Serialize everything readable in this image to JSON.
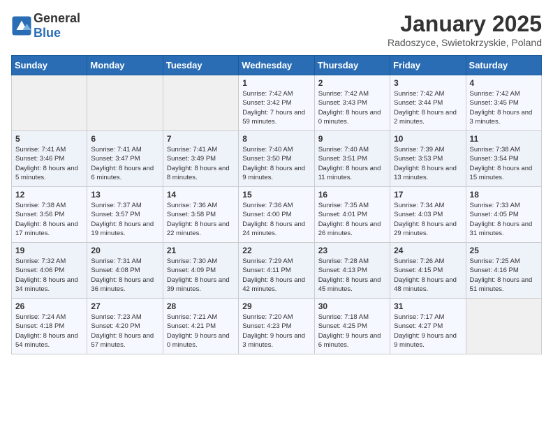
{
  "header": {
    "logo_general": "General",
    "logo_blue": "Blue",
    "title": "January 2025",
    "subtitle": "Radoszyce, Swietokrzyskie, Poland"
  },
  "weekdays": [
    "Sunday",
    "Monday",
    "Tuesday",
    "Wednesday",
    "Thursday",
    "Friday",
    "Saturday"
  ],
  "weeks": [
    [
      {
        "day": "",
        "empty": true
      },
      {
        "day": "",
        "empty": true
      },
      {
        "day": "",
        "empty": true
      },
      {
        "day": "1",
        "sunrise": "7:42 AM",
        "sunset": "3:42 PM",
        "daylight": "Daylight: 7 hours and 59 minutes."
      },
      {
        "day": "2",
        "sunrise": "7:42 AM",
        "sunset": "3:43 PM",
        "daylight": "Daylight: 8 hours and 0 minutes."
      },
      {
        "day": "3",
        "sunrise": "7:42 AM",
        "sunset": "3:44 PM",
        "daylight": "Daylight: 8 hours and 2 minutes."
      },
      {
        "day": "4",
        "sunrise": "7:42 AM",
        "sunset": "3:45 PM",
        "daylight": "Daylight: 8 hours and 3 minutes."
      }
    ],
    [
      {
        "day": "5",
        "sunrise": "7:41 AM",
        "sunset": "3:46 PM",
        "daylight": "Daylight: 8 hours and 5 minutes."
      },
      {
        "day": "6",
        "sunrise": "7:41 AM",
        "sunset": "3:47 PM",
        "daylight": "Daylight: 8 hours and 6 minutes."
      },
      {
        "day": "7",
        "sunrise": "7:41 AM",
        "sunset": "3:49 PM",
        "daylight": "Daylight: 8 hours and 8 minutes."
      },
      {
        "day": "8",
        "sunrise": "7:40 AM",
        "sunset": "3:50 PM",
        "daylight": "Daylight: 8 hours and 9 minutes."
      },
      {
        "day": "9",
        "sunrise": "7:40 AM",
        "sunset": "3:51 PM",
        "daylight": "Daylight: 8 hours and 11 minutes."
      },
      {
        "day": "10",
        "sunrise": "7:39 AM",
        "sunset": "3:53 PM",
        "daylight": "Daylight: 8 hours and 13 minutes."
      },
      {
        "day": "11",
        "sunrise": "7:38 AM",
        "sunset": "3:54 PM",
        "daylight": "Daylight: 8 hours and 15 minutes."
      }
    ],
    [
      {
        "day": "12",
        "sunrise": "7:38 AM",
        "sunset": "3:56 PM",
        "daylight": "Daylight: 8 hours and 17 minutes."
      },
      {
        "day": "13",
        "sunrise": "7:37 AM",
        "sunset": "3:57 PM",
        "daylight": "Daylight: 8 hours and 19 minutes."
      },
      {
        "day": "14",
        "sunrise": "7:36 AM",
        "sunset": "3:58 PM",
        "daylight": "Daylight: 8 hours and 22 minutes."
      },
      {
        "day": "15",
        "sunrise": "7:36 AM",
        "sunset": "4:00 PM",
        "daylight": "Daylight: 8 hours and 24 minutes."
      },
      {
        "day": "16",
        "sunrise": "7:35 AM",
        "sunset": "4:01 PM",
        "daylight": "Daylight: 8 hours and 26 minutes."
      },
      {
        "day": "17",
        "sunrise": "7:34 AM",
        "sunset": "4:03 PM",
        "daylight": "Daylight: 8 hours and 29 minutes."
      },
      {
        "day": "18",
        "sunrise": "7:33 AM",
        "sunset": "4:05 PM",
        "daylight": "Daylight: 8 hours and 31 minutes."
      }
    ],
    [
      {
        "day": "19",
        "sunrise": "7:32 AM",
        "sunset": "4:06 PM",
        "daylight": "Daylight: 8 hours and 34 minutes."
      },
      {
        "day": "20",
        "sunrise": "7:31 AM",
        "sunset": "4:08 PM",
        "daylight": "Daylight: 8 hours and 36 minutes."
      },
      {
        "day": "21",
        "sunrise": "7:30 AM",
        "sunset": "4:09 PM",
        "daylight": "Daylight: 8 hours and 39 minutes."
      },
      {
        "day": "22",
        "sunrise": "7:29 AM",
        "sunset": "4:11 PM",
        "daylight": "Daylight: 8 hours and 42 minutes."
      },
      {
        "day": "23",
        "sunrise": "7:28 AM",
        "sunset": "4:13 PM",
        "daylight": "Daylight: 8 hours and 45 minutes."
      },
      {
        "day": "24",
        "sunrise": "7:26 AM",
        "sunset": "4:15 PM",
        "daylight": "Daylight: 8 hours and 48 minutes."
      },
      {
        "day": "25",
        "sunrise": "7:25 AM",
        "sunset": "4:16 PM",
        "daylight": "Daylight: 8 hours and 51 minutes."
      }
    ],
    [
      {
        "day": "26",
        "sunrise": "7:24 AM",
        "sunset": "4:18 PM",
        "daylight": "Daylight: 8 hours and 54 minutes."
      },
      {
        "day": "27",
        "sunrise": "7:23 AM",
        "sunset": "4:20 PM",
        "daylight": "Daylight: 8 hours and 57 minutes."
      },
      {
        "day": "28",
        "sunrise": "7:21 AM",
        "sunset": "4:21 PM",
        "daylight": "Daylight: 9 hours and 0 minutes."
      },
      {
        "day": "29",
        "sunrise": "7:20 AM",
        "sunset": "4:23 PM",
        "daylight": "Daylight: 9 hours and 3 minutes."
      },
      {
        "day": "30",
        "sunrise": "7:18 AM",
        "sunset": "4:25 PM",
        "daylight": "Daylight: 9 hours and 6 minutes."
      },
      {
        "day": "31",
        "sunrise": "7:17 AM",
        "sunset": "4:27 PM",
        "daylight": "Daylight: 9 hours and 9 minutes."
      },
      {
        "day": "",
        "empty": true
      }
    ]
  ]
}
